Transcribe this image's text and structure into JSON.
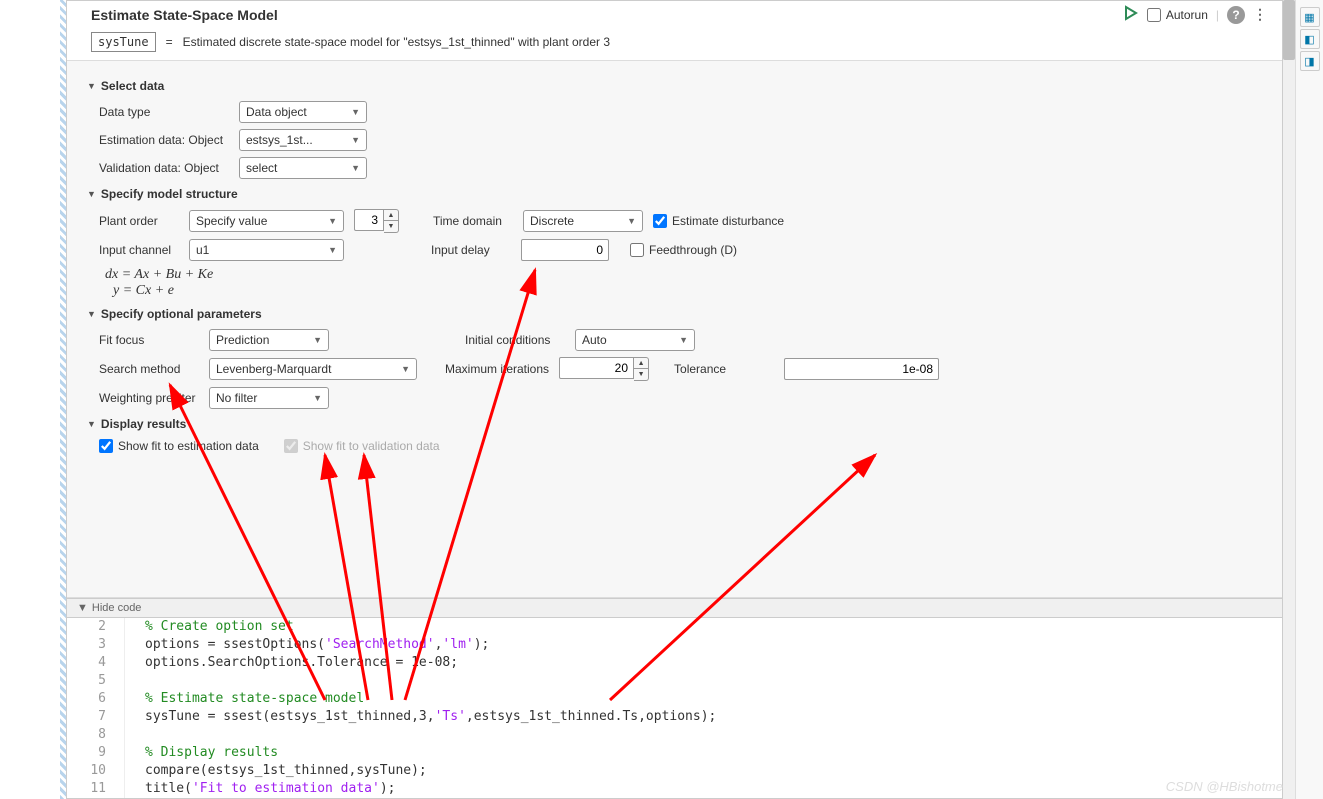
{
  "header": {
    "title": "Estimate State-Space Model",
    "autorun_label": "Autorun"
  },
  "output": {
    "var_name": "sysTune",
    "equals": " =  ",
    "description": "Estimated discrete state-space model for \"estsys_1st_thinned\" with plant order 3"
  },
  "sections": {
    "select_data": {
      "heading": "Select data",
      "data_type_label": "Data type",
      "data_type_value": "Data object",
      "estimation_label": "Estimation data: Object",
      "estimation_value": "estsys_1st...",
      "validation_label": "Validation data: Object",
      "validation_value": "select"
    },
    "model_structure": {
      "heading": "Specify model structure",
      "plant_order_label": "Plant order",
      "plant_order_mode": "Specify value",
      "plant_order_value": "3",
      "time_domain_label": "Time domain",
      "time_domain_value": "Discrete",
      "estimate_disturbance_label": "Estimate disturbance",
      "input_channel_label": "Input channel",
      "input_channel_value": "u1",
      "input_delay_label": "Input delay",
      "input_delay_value": "0",
      "feedthrough_label": "Feedthrough (D)",
      "eq1": "dx = Ax + Bu + Ke",
      "eq2": "y = Cx + e"
    },
    "optional_params": {
      "heading": "Specify optional parameters",
      "fit_focus_label": "Fit focus",
      "fit_focus_value": "Prediction",
      "initial_cond_label": "Initial conditions",
      "initial_cond_value": "Auto",
      "search_method_label": "Search method",
      "search_method_value": "Levenberg-Marquardt",
      "max_iter_label": "Maximum iterations",
      "max_iter_value": "20",
      "tolerance_label": "Tolerance",
      "tolerance_value": "1e-08",
      "weight_prefilter_label": "Weighting prefilter",
      "weight_prefilter_value": "No filter"
    },
    "display_results": {
      "heading": "Display results",
      "show_fit_est_label": "Show fit to estimation data",
      "show_fit_val_label": "Show fit to validation data"
    }
  },
  "hide_code": "Hide code",
  "code": {
    "line_numbers": [
      "2",
      "3",
      "4",
      "5",
      "6",
      "7",
      "8",
      "9",
      "10",
      "11"
    ],
    "lines": [
      {
        "t": "comment",
        "text": "% Create option set"
      },
      {
        "parts": [
          {
            "t": "plain",
            "text": "options = ssestOptions("
          },
          {
            "t": "string",
            "text": "'SearchMethod'"
          },
          {
            "t": "plain",
            "text": ","
          },
          {
            "t": "string",
            "text": "'lm'"
          },
          {
            "t": "plain",
            "text": ");"
          }
        ]
      },
      {
        "t": "plain",
        "text": "options.SearchOptions.Tolerance = 1e-08;"
      },
      {
        "t": "plain",
        "text": ""
      },
      {
        "t": "comment",
        "text": "% Estimate state-space model"
      },
      {
        "parts": [
          {
            "t": "plain",
            "text": "sysTune = ssest(estsys_1st_thinned,3,"
          },
          {
            "t": "string",
            "text": "'Ts'"
          },
          {
            "t": "plain",
            "text": ",estsys_1st_thinned.Ts,options);"
          }
        ]
      },
      {
        "t": "plain",
        "text": ""
      },
      {
        "t": "comment",
        "text": "% Display results"
      },
      {
        "t": "plain",
        "text": "compare(estsys_1st_thinned,sysTune);"
      },
      {
        "parts": [
          {
            "t": "plain",
            "text": "title("
          },
          {
            "t": "string",
            "text": "'Fit to estimation data'"
          },
          {
            "t": "plain",
            "text": ");"
          }
        ]
      }
    ]
  },
  "watermark": "CSDN @HBishotme"
}
